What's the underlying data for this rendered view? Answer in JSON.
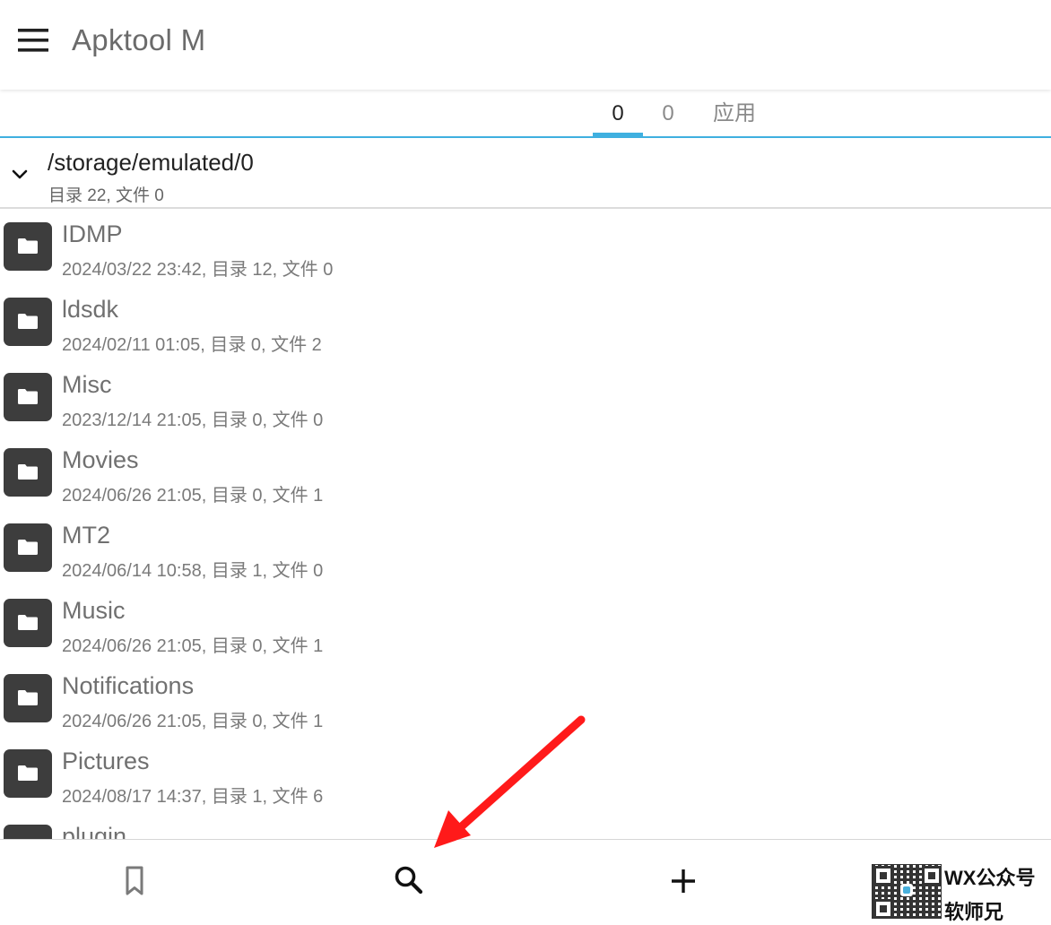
{
  "appbar": {
    "title": "Apktool M",
    "menu_icon": "hamburger-menu-icon"
  },
  "tabs": [
    {
      "label": "0",
      "selected": true
    },
    {
      "label": "0",
      "selected": false
    },
    {
      "label": "应用",
      "selected": false
    }
  ],
  "accent_color": "#3fb0e0",
  "path_header": {
    "path": "/storage/emulated/0",
    "summary": "目录 22, 文件 0"
  },
  "entries": [
    {
      "name": "IDMP",
      "meta": "2024/03/22 23:42, 目录 12, 文件 0"
    },
    {
      "name": "ldsdk",
      "meta": "2024/02/11 01:05, 目录 0, 文件 2"
    },
    {
      "name": "Misc",
      "meta": "2023/12/14 21:05, 目录 0, 文件 0"
    },
    {
      "name": "Movies",
      "meta": "2024/06/26 21:05, 目录 0, 文件 1"
    },
    {
      "name": "MT2",
      "meta": "2024/06/14 10:58, 目录 1, 文件 0"
    },
    {
      "name": "Music",
      "meta": "2024/06/26 21:05, 目录 0, 文件 1"
    },
    {
      "name": "Notifications",
      "meta": "2024/06/26 21:05, 目录 0, 文件 1"
    },
    {
      "name": "Pictures",
      "meta": "2024/08/17 14:37, 目录 1, 文件 6"
    },
    {
      "name": "plugin",
      "meta": ""
    }
  ],
  "bottom_nav": {
    "icons": [
      "bookmark-icon",
      "search-icon",
      "add-icon"
    ]
  },
  "watermark": {
    "line1": "WX公众号",
    "line2": "软师兄"
  },
  "annotation": {
    "arrow_color": "#ff1a1a",
    "points_to": "search-icon"
  }
}
